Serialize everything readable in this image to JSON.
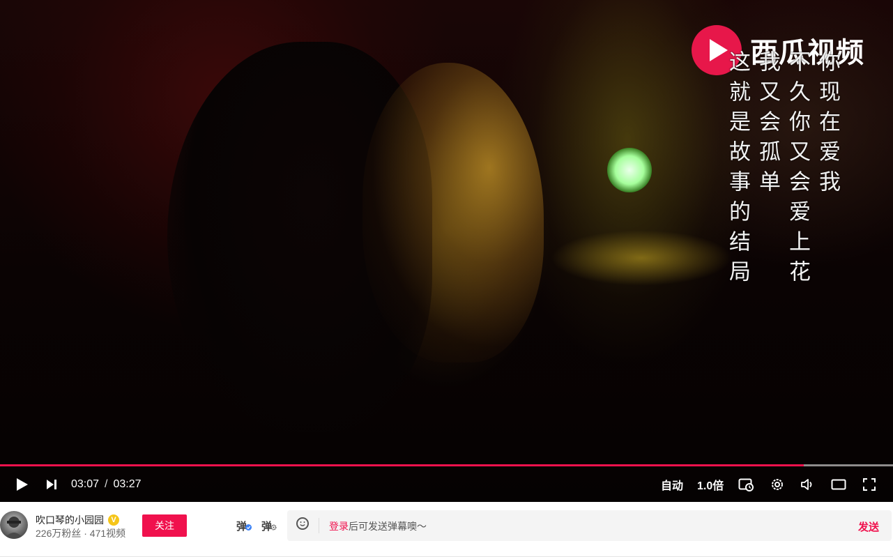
{
  "logo": {
    "text": "西瓜视频",
    "icon": "watermelon-play-icon"
  },
  "lyrics": {
    "columns": [
      "你现在爱我",
      "不久你又会爱上花",
      "我又会孤单",
      "这就是故事的结局"
    ]
  },
  "player": {
    "progress_fraction": 0.9,
    "current_time": "03:07",
    "separator": "/",
    "total_time": "03:27",
    "quality_label": "自动",
    "speed_label": "1.0倍",
    "icons": [
      "play-icon",
      "next-icon",
      "pip-icon",
      "settings-icon",
      "volume-icon",
      "theater-mode-icon",
      "fullscreen-icon"
    ]
  },
  "channel": {
    "name": "吹口琴的小园园",
    "badge": "V",
    "stats": "226万粉丝 · 471视频",
    "follow_label": "关注"
  },
  "danmu": {
    "toggle_label": "弹",
    "settings_label": "弹",
    "login_link": "登录",
    "placeholder": "后可发送弹幕噢～",
    "send_label": "发送"
  },
  "colors": {
    "accent": "#f0114d",
    "logo_red": "#e7174a"
  }
}
